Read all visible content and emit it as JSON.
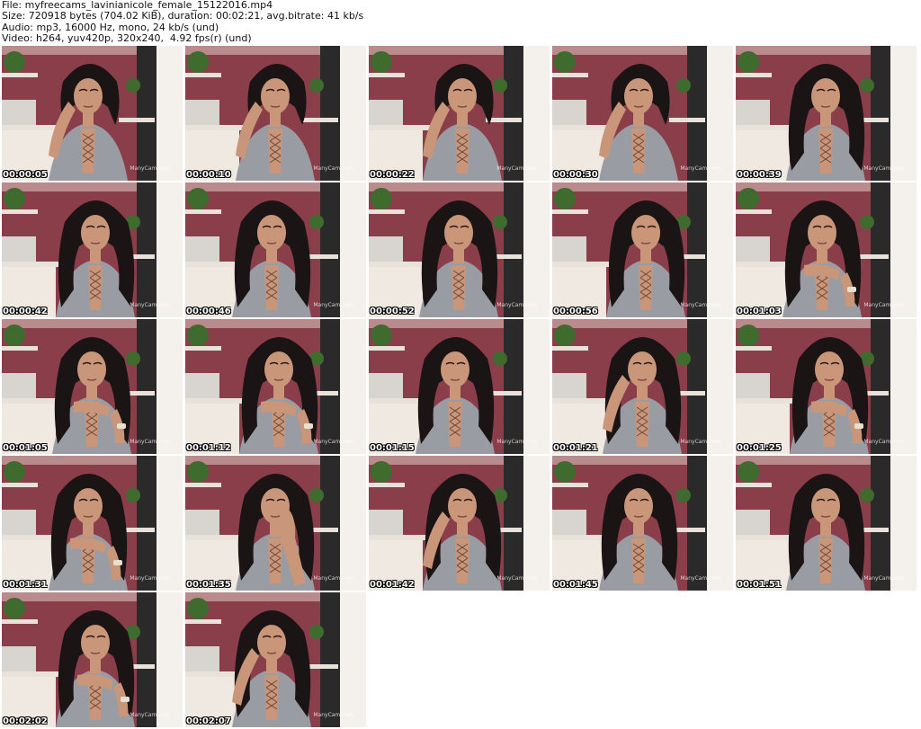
{
  "header": {
    "file": "File: myfreecams_lavinianicole_female_15122016.mp4",
    "size": "Size: 720918 bytes (704.02 KiB), duration: 00:02:21, avg.bitrate: 41 kb/s",
    "audio": "Audio: mp3, 16000 Hz, mono, 24 kb/s (und)",
    "video": "Video: h264, yuv420p, 320x240,  4.92 fps(r) (und)"
  },
  "watermark": "ManyCam.com",
  "frames": [
    {
      "timestamp": "00:00:05",
      "pose": "hand-ear",
      "hair": "up"
    },
    {
      "timestamp": "00:00:10",
      "pose": "hand-ear",
      "hair": "up"
    },
    {
      "timestamp": "00:00:22",
      "pose": "hand-ear",
      "hair": "up"
    },
    {
      "timestamp": "00:00:30",
      "pose": "hand-ear",
      "hair": "up"
    },
    {
      "timestamp": "00:00:39",
      "pose": "neutral",
      "hair": "down"
    },
    {
      "timestamp": "00:00:42",
      "pose": "neutral",
      "hair": "down"
    },
    {
      "timestamp": "00:00:46",
      "pose": "neutral",
      "hair": "down"
    },
    {
      "timestamp": "00:00:52",
      "pose": "neutral",
      "hair": "down"
    },
    {
      "timestamp": "00:00:56",
      "pose": "neutral",
      "hair": "down"
    },
    {
      "timestamp": "00:01:03",
      "pose": "hand-chin",
      "hair": "down"
    },
    {
      "timestamp": "00:01:05",
      "pose": "hand-chin",
      "hair": "down"
    },
    {
      "timestamp": "00:01:12",
      "pose": "hand-chin",
      "hair": "down"
    },
    {
      "timestamp": "00:01:15",
      "pose": "neutral",
      "hair": "down"
    },
    {
      "timestamp": "00:01:21",
      "pose": "hand-ear",
      "hair": "down"
    },
    {
      "timestamp": "00:01:25",
      "pose": "hand-chin",
      "hair": "down"
    },
    {
      "timestamp": "00:01:31",
      "pose": "hand-chin",
      "hair": "down"
    },
    {
      "timestamp": "00:01:35",
      "pose": "hand-face",
      "hair": "down"
    },
    {
      "timestamp": "00:01:42",
      "pose": "hand-ear",
      "hair": "down"
    },
    {
      "timestamp": "00:01:45",
      "pose": "neutral",
      "hair": "down"
    },
    {
      "timestamp": "00:01:51",
      "pose": "neutral",
      "hair": "down"
    },
    {
      "timestamp": "00:02:02",
      "pose": "hand-chin",
      "hair": "down"
    },
    {
      "timestamp": "00:02:07",
      "pose": "hand-ear",
      "hair": "down"
    }
  ],
  "colors": {
    "wall": "#8a3e4a",
    "shelf": "#e8e2da",
    "skin": "#c9967a",
    "top": "#9a9ca3",
    "hair": "#1b1414",
    "plant": "#3f6b2f",
    "door": "#2a2a2a"
  }
}
